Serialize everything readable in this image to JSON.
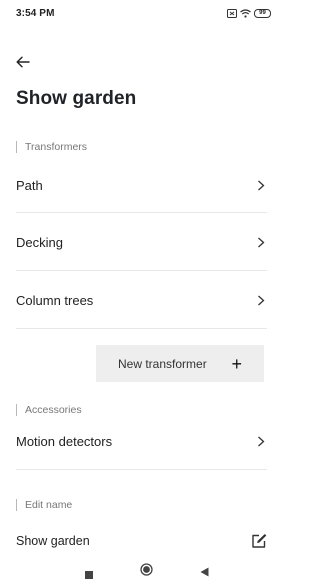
{
  "status_bar": {
    "time": "3:54 PM",
    "battery_level": "99"
  },
  "header": {
    "title": "Show garden"
  },
  "icons": {
    "back": "arrow-left-icon",
    "chevron": "chevron-right-icon",
    "plus": "plus-icon",
    "edit": "edit-pencil-icon",
    "nav_recent": "square-icon",
    "nav_home": "circle-icon",
    "nav_back": "triangle-back-icon"
  },
  "transformers": {
    "section_label": "Transformers",
    "items": [
      {
        "label": "Path"
      },
      {
        "label": "Decking"
      },
      {
        "label": "Column trees"
      }
    ],
    "new_button_label": "New transformer",
    "new_button_glyph": "+"
  },
  "accessories": {
    "section_label": "Accessories",
    "items": [
      {
        "label": "Motion detectors"
      }
    ]
  },
  "edit_name": {
    "section_label": "Edit name",
    "value": "Show garden"
  }
}
